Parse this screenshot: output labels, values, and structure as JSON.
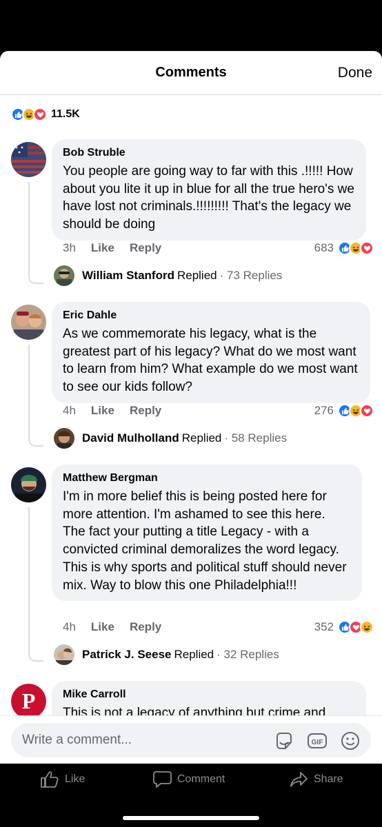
{
  "header": {
    "title": "Comments",
    "done_label": "Done"
  },
  "summary": {
    "reaction_icons": [
      "like-icon",
      "haha-icon",
      "love-icon"
    ],
    "count": "11.5K"
  },
  "comments": [
    {
      "author": "Bob Struble",
      "text": "You people are going way to far with this .!!!!! How about you lite it up in blue for all the true hero's we have lost not criminals.!!!!!!!!! That's the legacy we should be doing",
      "time": "3h",
      "like_label": "Like",
      "reply_label": "Reply",
      "reaction_count": "683",
      "reactions": [
        "like-icon",
        "haha-icon",
        "love-icon"
      ],
      "reply_summary": {
        "name": "William Stanford",
        "word": "Replied",
        "count": "· 73 Replies"
      }
    },
    {
      "author": "Eric Dahle",
      "text": "As we commemorate his legacy, what is the greatest part of his legacy?  What do we most want to learn from him?  What example do we most want to see our kids follow?",
      "time": "4h",
      "like_label": "Like",
      "reply_label": "Reply",
      "reaction_count": "276",
      "reactions": [
        "like-icon",
        "haha-icon",
        "love-icon"
      ],
      "reply_summary": {
        "name": "David Mulholland",
        "word": "Replied",
        "count": "· 58 Replies"
      }
    },
    {
      "author": "Matthew Bergman",
      "text": "I'm in more belief this is  being posted here for more attention. I'm ashamed to see this here. The fact your putting a title Legacy - with a convicted criminal demoralizes the word legacy. This is why sports and political stuff should never mix.  Way to blow this one Philadelphia!!!",
      "time": "4h",
      "like_label": "Like",
      "reply_label": "Reply",
      "reaction_count": "352",
      "reactions": [
        "like-icon",
        "love-icon",
        "haha-icon"
      ],
      "reply_summary": {
        "name": "Patrick J. Seese",
        "word": "Replied",
        "count": "· 32 Replies"
      }
    },
    {
      "author": "Mike Carroll",
      "text": "This is not a legacy of anything but crime and"
    }
  ],
  "composer": {
    "placeholder": "Write a comment..."
  },
  "bottom_bar": {
    "like": "Like",
    "comment": "Comment",
    "share": "Share"
  },
  "colors": {
    "facebook_blue": "#1877f2",
    "love_red": "#f33e58",
    "haha_yellow": "#f7b928",
    "bubble_gray": "#f0f2f5"
  }
}
